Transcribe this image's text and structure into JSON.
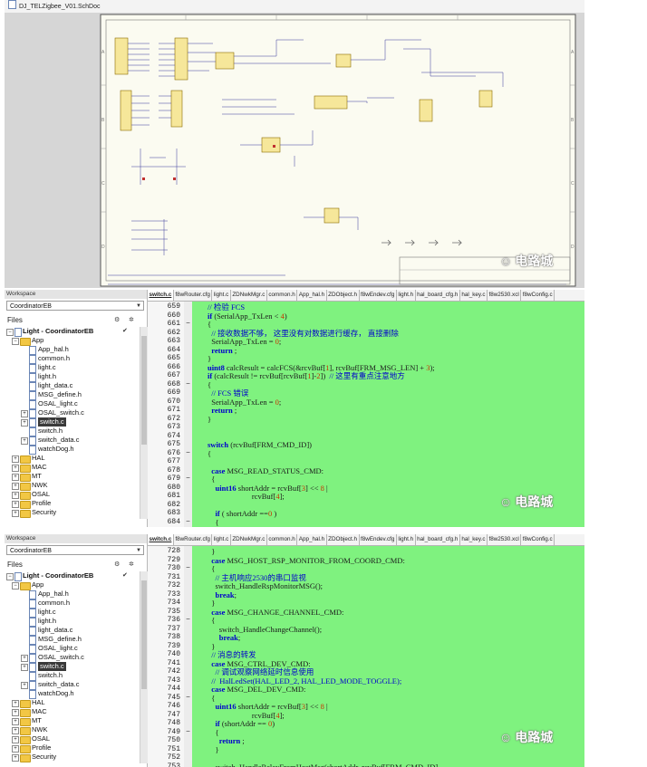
{
  "schematic": {
    "doc_title": "DJ_TELZigbee_V01.SchDoc",
    "left_markers": [
      "A",
      "B",
      "C",
      "D"
    ],
    "right_markers": [
      "A",
      "B",
      "C",
      "D"
    ],
    "watermark": "电路城"
  },
  "editor1": {
    "workspace_label": "Workspace",
    "config": "CoordinatorEB",
    "files_label": "Files",
    "project": "Light - CoordinatorEB",
    "tree": [
      {
        "label": "App",
        "type": "folder",
        "toggle": "−",
        "depth": 1
      },
      {
        "label": "App_hal.h",
        "type": "file",
        "depth": 2
      },
      {
        "label": "common.h",
        "type": "file",
        "depth": 2
      },
      {
        "label": "light.c",
        "type": "file",
        "depth": 2
      },
      {
        "label": "light.h",
        "type": "file",
        "depth": 2
      },
      {
        "label": "light_data.c",
        "type": "file",
        "depth": 2
      },
      {
        "label": "MSG_define.h",
        "type": "file",
        "depth": 2
      },
      {
        "label": "OSAL_light.c",
        "type": "file",
        "depth": 2
      },
      {
        "label": "OSAL_switch.c",
        "type": "file",
        "toggle": "+",
        "depth": 2
      },
      {
        "label": "switch.c",
        "type": "file",
        "toggle": "+",
        "depth": 2,
        "selected": true
      },
      {
        "label": "switch.h",
        "type": "file",
        "depth": 2
      },
      {
        "label": "switch_data.c",
        "type": "file",
        "toggle": "+",
        "depth": 2
      },
      {
        "label": "watchDog.h",
        "type": "file",
        "depth": 2
      },
      {
        "label": "HAL",
        "type": "folder",
        "toggle": "+",
        "depth": 1
      },
      {
        "label": "MAC",
        "type": "folder",
        "toggle": "+",
        "depth": 1
      },
      {
        "label": "MT",
        "type": "folder",
        "toggle": "+",
        "depth": 1
      },
      {
        "label": "NWK",
        "type": "folder",
        "toggle": "+",
        "depth": 1
      },
      {
        "label": "OSAL",
        "type": "folder",
        "toggle": "+",
        "depth": 1
      },
      {
        "label": "Profile",
        "type": "folder",
        "toggle": "+",
        "depth": 1
      },
      {
        "label": "Security",
        "type": "folder",
        "toggle": "+",
        "depth": 1
      }
    ],
    "tabs": [
      "switch.c",
      "f8wRouter.cfg",
      "light.c",
      "ZDNwkMgr.c",
      "common.h",
      "App_hal.h",
      "ZDObject.h",
      "f8wEndev.cfg",
      "light.h",
      "hal_board_cfg.h",
      "hal_key.c",
      "f8w2530.xcl",
      "f8wConfig.c"
    ],
    "active_tab": 0,
    "lines": [
      {
        "n": "659",
        "f": "",
        "t": "        // 检验 FCS"
      },
      {
        "n": "660",
        "f": "",
        "t": "        if (SerialApp_TxLen < 4)"
      },
      {
        "n": "661",
        "f": "−",
        "t": "        {"
      },
      {
        "n": "662",
        "f": "",
        "t": "          // 接收数据不够， 这里没有对数据进行缓存， 直接删除"
      },
      {
        "n": "663",
        "f": "",
        "t": "          SerialApp_TxLen = 0;"
      },
      {
        "n": "664",
        "f": "",
        "t": "          return ;"
      },
      {
        "n": "665",
        "f": "",
        "t": "        }"
      },
      {
        "n": "666",
        "f": "",
        "t": "        uint8 calcResult = calcFCS(&rcvBuf[1], rcvBuf[FRM_MSG_LEN] + 3);"
      },
      {
        "n": "667",
        "f": "",
        "t": "        if (calcResult != rcvBuf[rcvBuf[1]-2])  // 这里有重点注意地方"
      },
      {
        "n": "668",
        "f": "−",
        "t": "        {"
      },
      {
        "n": "669",
        "f": "",
        "t": "          // FCS 错误"
      },
      {
        "n": "670",
        "f": "",
        "t": "          SerialApp_TxLen = 0;"
      },
      {
        "n": "671",
        "f": "",
        "t": "          return ;"
      },
      {
        "n": "672",
        "f": "",
        "t": "        }"
      },
      {
        "n": "673",
        "f": "",
        "t": ""
      },
      {
        "n": "674",
        "f": "",
        "t": ""
      },
      {
        "n": "675",
        "f": "",
        "t": "        switch (rcvBuf[FRM_CMD_ID])"
      },
      {
        "n": "676",
        "f": "−",
        "t": "        {"
      },
      {
        "n": "677",
        "f": "",
        "t": ""
      },
      {
        "n": "678",
        "f": "",
        "t": "          case MSG_READ_STATUS_CMD:"
      },
      {
        "n": "679",
        "f": "−",
        "t": "          {"
      },
      {
        "n": "680",
        "f": "",
        "t": "            uint16 shortAddr = rcvBuf[3] << 8 |"
      },
      {
        "n": "681",
        "f": "",
        "t": "                               rcvBuf[4];"
      },
      {
        "n": "682",
        "f": "",
        "t": ""
      },
      {
        "n": "683",
        "f": "",
        "t": "            if ( shortAddr ==0 )"
      },
      {
        "n": "684",
        "f": "−",
        "t": "            {"
      }
    ]
  },
  "editor2": {
    "workspace_label": "Workspace",
    "config": "CoordinatorEB",
    "files_label": "Files",
    "project": "Light - CoordinatorEB",
    "tree": [
      {
        "label": "App",
        "type": "folder",
        "toggle": "−",
        "depth": 1
      },
      {
        "label": "App_hal.h",
        "type": "file",
        "depth": 2
      },
      {
        "label": "common.h",
        "type": "file",
        "depth": 2
      },
      {
        "label": "light.c",
        "type": "file",
        "depth": 2
      },
      {
        "label": "light.h",
        "type": "file",
        "depth": 2
      },
      {
        "label": "light_data.c",
        "type": "file",
        "depth": 2
      },
      {
        "label": "MSG_define.h",
        "type": "file",
        "depth": 2
      },
      {
        "label": "OSAL_light.c",
        "type": "file",
        "depth": 2
      },
      {
        "label": "OSAL_switch.c",
        "type": "file",
        "toggle": "+",
        "depth": 2
      },
      {
        "label": "switch.c",
        "type": "file",
        "toggle": "+",
        "depth": 2,
        "selected": true
      },
      {
        "label": "switch.h",
        "type": "file",
        "depth": 2
      },
      {
        "label": "switch_data.c",
        "type": "file",
        "toggle": "+",
        "depth": 2
      },
      {
        "label": "watchDog.h",
        "type": "file",
        "depth": 2
      },
      {
        "label": "HAL",
        "type": "folder",
        "toggle": "+",
        "depth": 1
      },
      {
        "label": "MAC",
        "type": "folder",
        "toggle": "+",
        "depth": 1
      },
      {
        "label": "MT",
        "type": "folder",
        "toggle": "+",
        "depth": 1
      },
      {
        "label": "NWK",
        "type": "folder",
        "toggle": "+",
        "depth": 1
      },
      {
        "label": "OSAL",
        "type": "folder",
        "toggle": "+",
        "depth": 1
      },
      {
        "label": "Profile",
        "type": "folder",
        "toggle": "+",
        "depth": 1
      },
      {
        "label": "Security",
        "type": "folder",
        "toggle": "+",
        "depth": 1
      }
    ],
    "tabs": [
      "switch.c",
      "f8wRouter.cfg",
      "light.c",
      "ZDNwkMgr.c",
      "common.h",
      "App_hal.h",
      "ZDObject.h",
      "f8wEndev.cfg",
      "light.h",
      "hal_board_cfg.h",
      "hal_key.c",
      "f8w2530.xcl",
      "f8wConfig.c"
    ],
    "active_tab": 0,
    "lines": [
      {
        "n": "728",
        "f": "",
        "t": "          }"
      },
      {
        "n": "729",
        "f": "",
        "t": "          case MSG_HOST_RSP_MONITOR_FROM_COORD_CMD:"
      },
      {
        "n": "730",
        "f": "−",
        "t": "          {"
      },
      {
        "n": "731",
        "f": "",
        "t": "            // 主机响应2530的串口监视"
      },
      {
        "n": "732",
        "f": "",
        "t": "            switch_HandleRspMonitorMSG();"
      },
      {
        "n": "733",
        "f": "",
        "t": "            break;"
      },
      {
        "n": "734",
        "f": "",
        "t": "          }"
      },
      {
        "n": "735",
        "f": "",
        "t": "          case MSG_CHANGE_CHANNEL_CMD:"
      },
      {
        "n": "736",
        "f": "−",
        "t": "          {"
      },
      {
        "n": "737",
        "f": "",
        "t": "              switch_HandleChangeChannel();"
      },
      {
        "n": "738",
        "f": "",
        "t": "              break;"
      },
      {
        "n": "739",
        "f": "",
        "t": "          }"
      },
      {
        "n": "740",
        "f": "",
        "t": "          // 消息的转发"
      },
      {
        "n": "741",
        "f": "",
        "t": "          case MSG_CTRL_DEV_CMD:"
      },
      {
        "n": "742",
        "f": "",
        "t": "            // 调试观察网络延时信息使用"
      },
      {
        "n": "743",
        "f": "",
        "t": "          //  HalLedSet(HAL_LED_2, HAL_LED_MODE_TOGGLE);"
      },
      {
        "n": "744",
        "f": "",
        "t": "          case MSG_DEL_DEV_CMD:"
      },
      {
        "n": "745",
        "f": "−",
        "t": "          {"
      },
      {
        "n": "746",
        "f": "",
        "t": "            uint16 shortAddr = rcvBuf[3] << 8 |"
      },
      {
        "n": "747",
        "f": "",
        "t": "                               rcvBuf[4];"
      },
      {
        "n": "748",
        "f": "",
        "t": "            if (shortAddr == 0)"
      },
      {
        "n": "749",
        "f": "−",
        "t": "            {"
      },
      {
        "n": "750",
        "f": "",
        "t": "              return ;"
      },
      {
        "n": "751",
        "f": "",
        "t": "            }"
      },
      {
        "n": "752",
        "f": "",
        "t": ""
      },
      {
        "n": "753",
        "f": "",
        "t": "            switch_HandleRelayFromHostMsg(shortAddr, rcvBuf[FRM_CMD_ID],"
      }
    ]
  },
  "watermarks": {
    "text": "电路城"
  },
  "colors": {
    "code_bg": "#7ff27f",
    "keyword": "#0000cc",
    "selection": "#3a3a3a",
    "folder": "#f2c744"
  }
}
